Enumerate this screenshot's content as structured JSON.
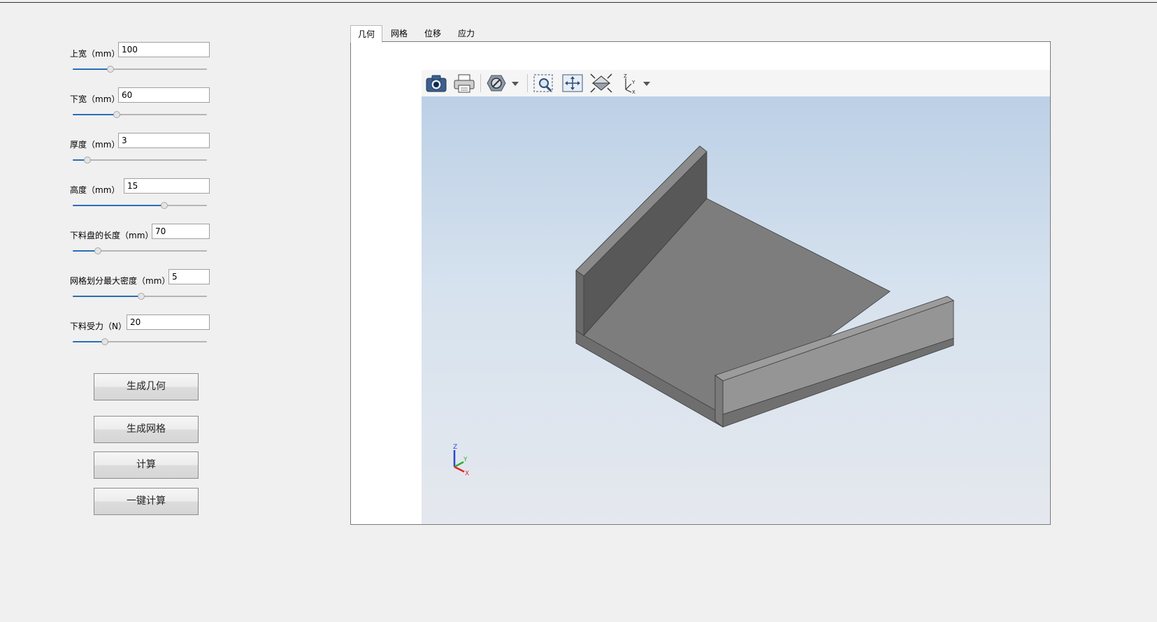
{
  "params": [
    {
      "label": "上宽（mm）",
      "value": "100",
      "slider": 0.28
    },
    {
      "label": "下宽（mm）",
      "value": "60",
      "slider": 0.33
    },
    {
      "label": "厚度（mm）",
      "value": "3",
      "slider": 0.11
    },
    {
      "label": "高度（mm）",
      "value": "15",
      "slider": 0.68
    },
    {
      "label": "下料盘的长度（mm）",
      "value": "70",
      "slider": 0.19
    },
    {
      "label": "网格划分最大密度（mm）",
      "value": "5",
      "slider": 0.51
    },
    {
      "label": "下料受力（N）",
      "value": "20",
      "slider": 0.24
    }
  ],
  "buttons": {
    "generate_geometry": "生成几何",
    "generate_mesh": "生成网格",
    "compute": "计算",
    "one_click_compute": "一键计算"
  },
  "tabs": [
    "几何",
    "网格",
    "位移",
    "应力"
  ],
  "active_tab": 0,
  "toolbar_icons": [
    "camera-icon",
    "print-icon",
    "display-mode-icon",
    "zoom-window-icon",
    "fit-all-icon",
    "view-fit-icon",
    "axes-icon"
  ],
  "axis_labels": {
    "z": "Z",
    "y": "Y",
    "x": "X"
  },
  "colors": {
    "accent": "#2a6db9",
    "axis_x": "#e0262a",
    "axis_y": "#2fb02f",
    "axis_z": "#2a45d8"
  }
}
